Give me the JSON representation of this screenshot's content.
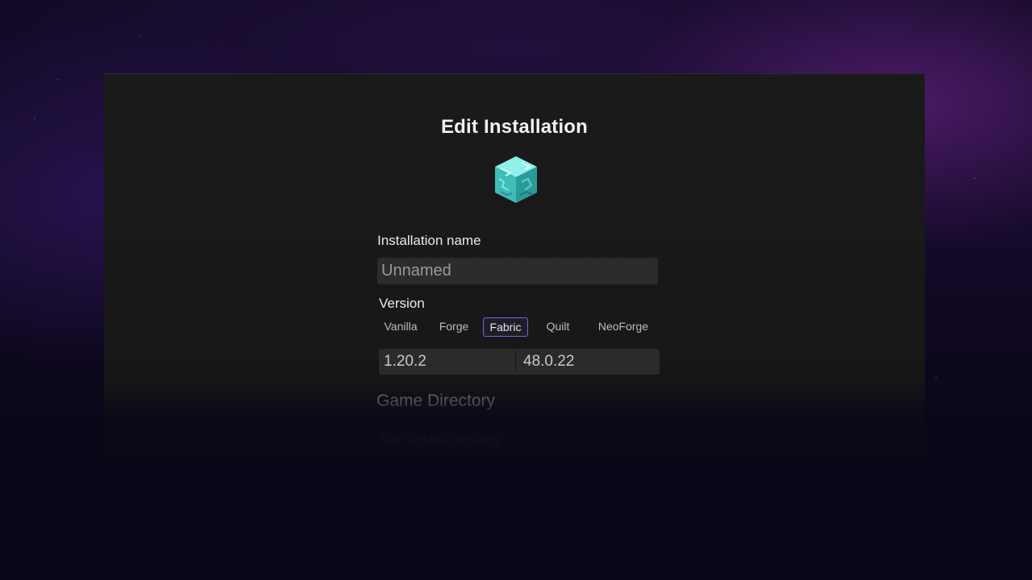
{
  "dialog": {
    "title": "Edit Installation",
    "icon": "diamond-block-icon",
    "name_label": "Installation name",
    "name_placeholder": "Unnamed",
    "name_value": "",
    "version_label": "Version",
    "loaders": [
      "Vanilla",
      "Forge",
      "Fabric",
      "Quilt",
      "NeoForge"
    ],
    "selected_loader": "Fabric",
    "game_version": "1.20.2",
    "loader_version": "48.0.22",
    "directory_label": "Game Directory",
    "directory_value": "Use default directory"
  },
  "colors": {
    "accent": "#7561e6",
    "panel": "#1a1a1a",
    "field": "#2c2c2c",
    "diamond": "#5fd8d3"
  }
}
